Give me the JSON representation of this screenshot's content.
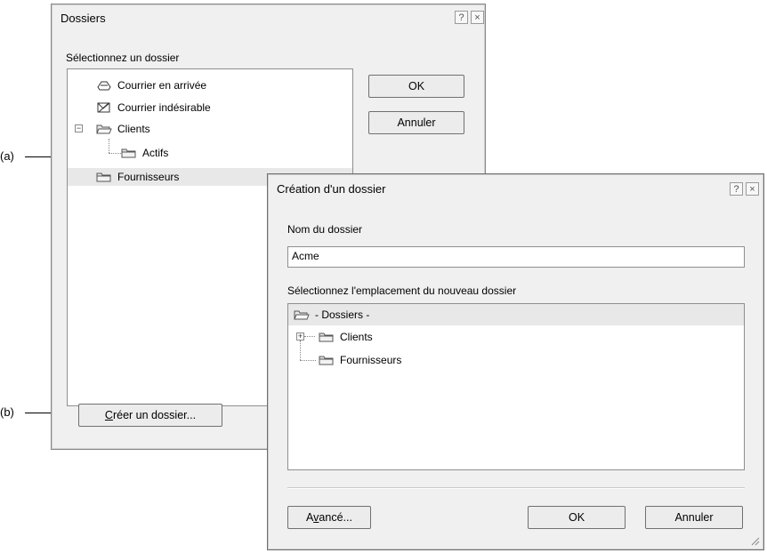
{
  "dialog_dossiers": {
    "title": "Dossiers",
    "help": "?",
    "close": "×",
    "select_label": "Sélectionnez un dossier",
    "tree": [
      {
        "label": "Courrier en arrivée",
        "icon": "inbox-icon"
      },
      {
        "label": "Courrier indésirable",
        "icon": "junk-mail-icon"
      },
      {
        "label": "Clients",
        "icon": "folder-open-icon"
      },
      {
        "label": "Actifs",
        "icon": "folder-icon"
      },
      {
        "label": "Fournisseurs",
        "icon": "folder-icon"
      }
    ],
    "ok": "OK",
    "cancel": "Annuler",
    "create_prefix": "C",
    "create_rest": "réer un dossier..."
  },
  "dialog_creation": {
    "title": "Création d'un dossier",
    "help": "?",
    "close": "×",
    "name_label": "Nom du dossier",
    "name_value": "Acme",
    "location_label": "Sélectionnez l'emplacement du nouveau dossier",
    "tree": [
      {
        "label": "- Dossiers -",
        "icon": "folder-open-icon"
      },
      {
        "label": "Clients",
        "icon": "folder-icon"
      },
      {
        "label": "Fournisseurs",
        "icon": "folder-icon"
      }
    ],
    "advanced_prefix": "A",
    "advanced_u": "v",
    "advanced_rest": "ancé...",
    "ok": "OK",
    "cancel": "Annuler"
  },
  "callouts": {
    "a": "(a)",
    "b": "(b)"
  }
}
